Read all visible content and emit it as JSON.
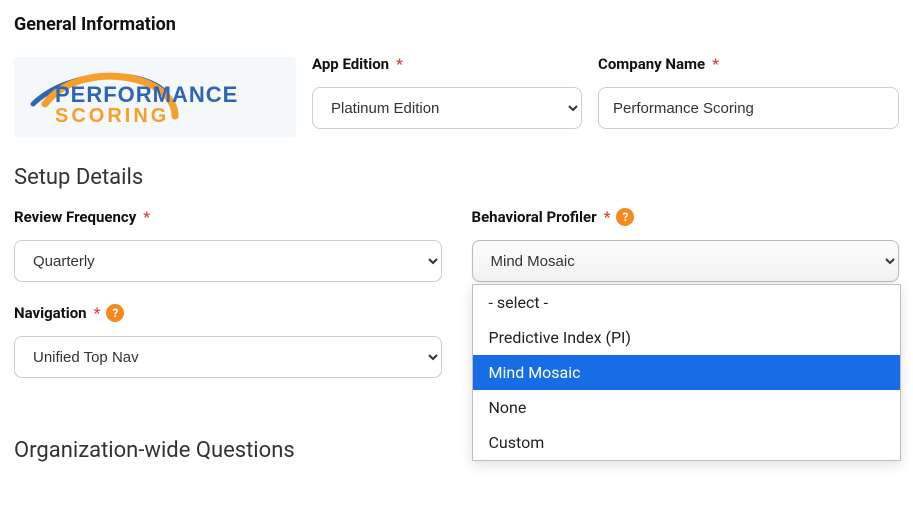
{
  "section_general": "General Information",
  "section_setup": "Setup Details",
  "section_org": "Organization-wide Questions",
  "logo": {
    "line1": "PERFORMANCE",
    "line2": "SCORING"
  },
  "app_edition": {
    "label": "App Edition",
    "value": "Platinum Edition"
  },
  "company_name": {
    "label": "Company Name",
    "value": "Performance Scoring"
  },
  "review_frequency": {
    "label": "Review Frequency",
    "value": "Quarterly"
  },
  "navigation": {
    "label": "Navigation",
    "value": "Unified Top Nav"
  },
  "behavioral_profiler": {
    "label": "Behavioral Profiler",
    "value": "Mind Mosaic",
    "options": [
      "- select -",
      "Predictive Index (PI)",
      "Mind Mosaic",
      "None",
      "Custom"
    ],
    "selected_index": 2
  },
  "required_marker": "*",
  "help_glyph": "?"
}
